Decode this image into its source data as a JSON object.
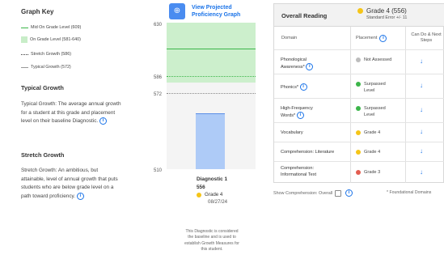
{
  "graph_key": {
    "title": "Graph Key",
    "items": [
      {
        "label": "Mid On Grade Level (609)"
      },
      {
        "label": "On Grade Level (581-640)"
      },
      {
        "label": "Stretch Growth (586)"
      },
      {
        "label": "Typical Growth (572)"
      }
    ]
  },
  "typical": {
    "title": "Typical Growth",
    "text": "Typical Growth: The average annual growth for a student at this grade and placement level on their baseline Diagnostic.",
    "info_icon": "info-icon"
  },
  "stretch": {
    "title": "Stretch Growth",
    "text": "Stretch Growth: An ambitious, but attainable, level of annual growth that puts students who are below grade level on a path toward proficiency.",
    "info_icon": "info-icon"
  },
  "projection": {
    "label": "View Projected Proficiency Graph",
    "icon": "zoom-icon"
  },
  "chart": {
    "ticks": [
      "630",
      "586",
      "572",
      "510"
    ],
    "diagnostic": {
      "title": "Diagnostic 1",
      "score": "556",
      "grade": "Grade 4",
      "date": "08/27/24"
    },
    "note": "This Diagnostic is considered the baseline and is used to establish Growth Measures for this student."
  },
  "chart_data": {
    "type": "bar",
    "categories": [
      "Diagnostic 1"
    ],
    "values": [
      556
    ],
    "ylim": [
      510,
      630
    ],
    "reference_lines": [
      {
        "name": "Mid On Grade Level",
        "value": 609
      },
      {
        "name": "Stretch Growth",
        "value": 586
      },
      {
        "name": "Typical Growth",
        "value": 572
      }
    ],
    "bands": [
      {
        "name": "On Grade Level",
        "from": 581,
        "to": 640
      }
    ]
  },
  "overall": {
    "title": "Overall Reading",
    "grade": "Grade 4 (556)",
    "error": "Standard Error +/- 11",
    "columns": [
      "Domain",
      "Placement",
      "Can Do & Next Steps"
    ],
    "rows": [
      {
        "domain": "Phonological Awareness*",
        "placement": "Not Assessed",
        "color": "#bdbdbd",
        "info": true
      },
      {
        "domain": "Phonics*",
        "placement": "Surpassed Level",
        "color": "#3cb54a",
        "info": true
      },
      {
        "domain": "High-Frequency Words*",
        "placement": "Surpassed Level",
        "color": "#3cb54a",
        "info": true
      },
      {
        "domain": "Vocabulary",
        "placement": "Grade 4",
        "color": "#f5c518",
        "info": false
      },
      {
        "domain": "Comprehension: Literature",
        "placement": "Grade 4",
        "color": "#f5c518",
        "info": false
      },
      {
        "domain": "Comprehension: Informational Text",
        "placement": "Grade 3",
        "color": "#e35d50",
        "info": false
      }
    ],
    "footer_left": "Show Comprehension: Overall",
    "footer_right": "* Foundational Domains"
  },
  "colors": {
    "accent": "#1a73e8",
    "on_grade_band": "#ccefcc",
    "mid_line": "#3cb54a",
    "bar": "#aecbf7",
    "grade_yellow": "#f5c518",
    "grade_red": "#e35d50",
    "surpassed_green": "#3cb54a",
    "not_assessed_grey": "#bdbdbd"
  }
}
